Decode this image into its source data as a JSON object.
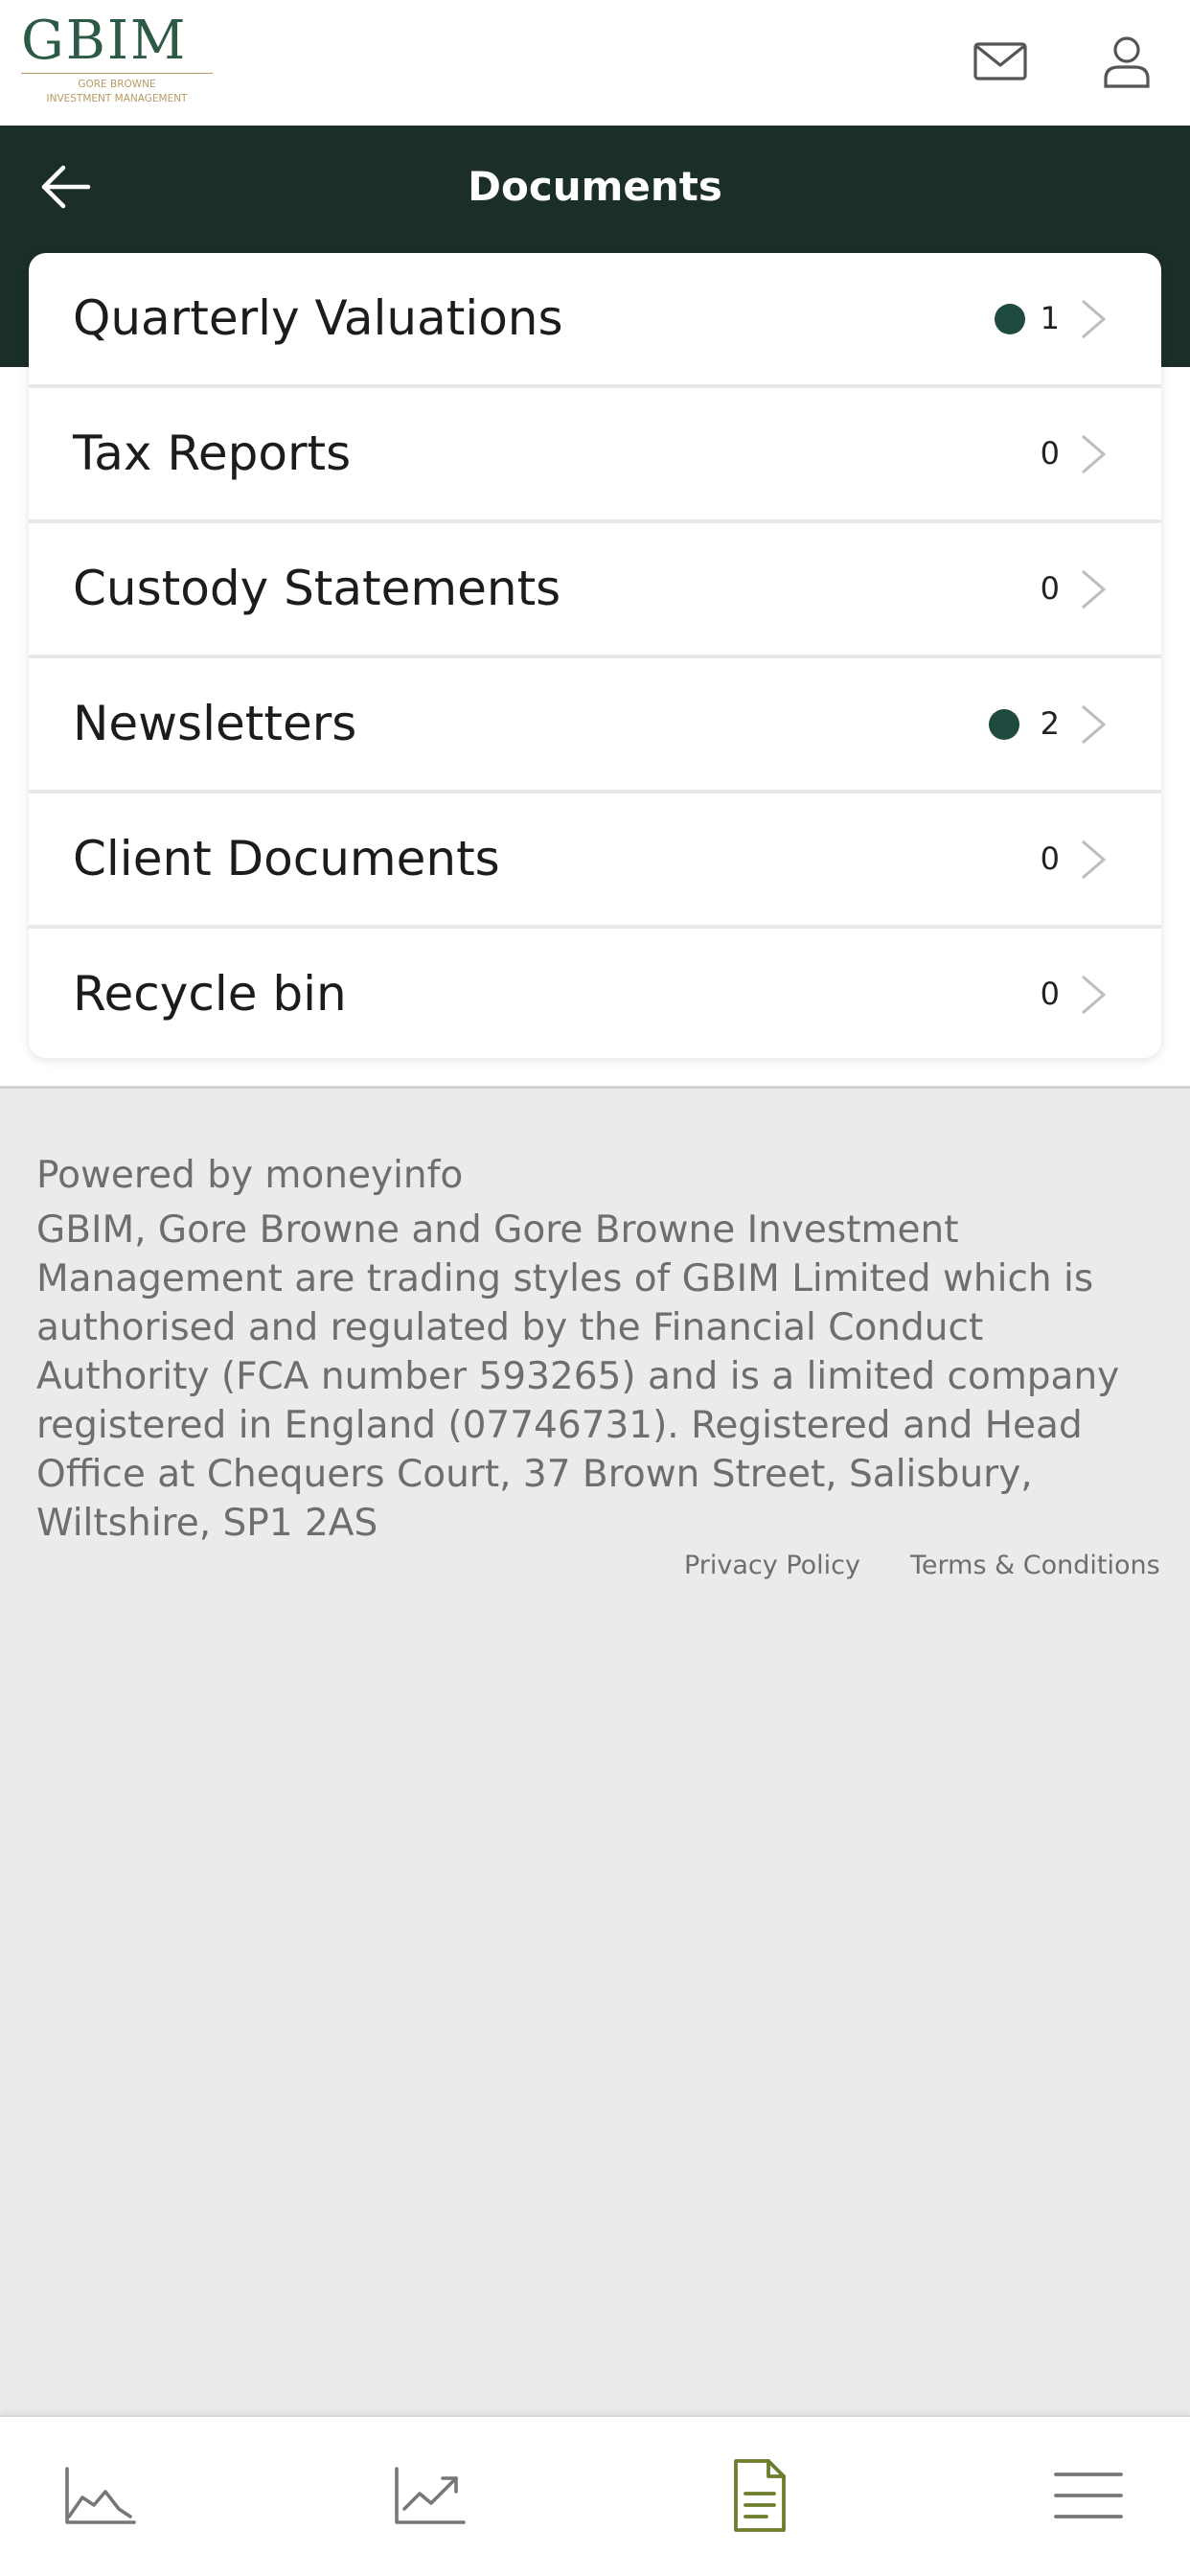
{
  "header": {
    "logo_text": "GBIM",
    "logo_sub_line1": "GORE BROWNE",
    "logo_sub_line2": "INVESTMENT MANAGEMENT",
    "icons": [
      "mail-icon",
      "user-icon"
    ]
  },
  "title_bar": {
    "title": "Documents",
    "back_icon": "arrow-left-icon"
  },
  "documents": [
    {
      "label": "Quarterly Valuations",
      "count": "1",
      "has_new": true
    },
    {
      "label": "Tax Reports",
      "count": "0",
      "has_new": false
    },
    {
      "label": "Custody Statements",
      "count": "0",
      "has_new": false
    },
    {
      "label": "Newsletters",
      "count": "2",
      "has_new": true
    },
    {
      "label": "Client Documents",
      "count": "0",
      "has_new": false
    },
    {
      "label": "Recycle bin",
      "count": "0",
      "has_new": false
    }
  ],
  "footer": {
    "powered_by": "Powered by moneyinfo",
    "legal": "GBIM, Gore Browne and Gore Browne Investment Management are trading styles of GBIM Limited which is authorised and regulated by the Financial Conduct Authority (FCA number 593265) and is a limited company registered in England (07746731). Registered and Head Office at Chequers Court, 37 Brown Street, Salisbury, Wiltshire, SP1 2AS",
    "privacy_link": "Privacy Policy",
    "terms_link": "Terms & Conditions"
  },
  "bottom_nav": {
    "items": [
      "area-chart-icon",
      "trend-up-icon",
      "document-icon",
      "menu-icon"
    ],
    "active_index": 2
  },
  "colors": {
    "brand_green": "#2c5a44",
    "title_band": "#1b2e29",
    "badge_dot": "#1f4a3f",
    "logo_gold": "#b89a64",
    "active_nav": "#6b7d2e"
  }
}
